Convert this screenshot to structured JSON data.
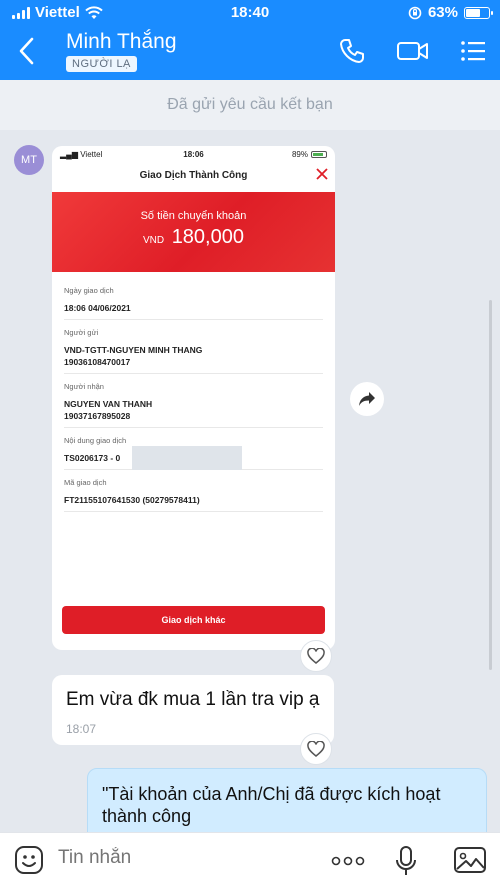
{
  "status_bar": {
    "carrier": "Viettel",
    "time": "18:40",
    "battery": "63%",
    "battery_level": 0.63
  },
  "header": {
    "contact_name": "Minh Thắng",
    "badge": "NGƯỜI LẠ"
  },
  "banner": {
    "text": "Đã gửi yêu cầu kết bạn"
  },
  "avatar": {
    "initials": "MT"
  },
  "receipt": {
    "status": {
      "carrier": "Viettel",
      "time": "18:06",
      "battery": "89%"
    },
    "title": "Giao Dịch Thành Công",
    "amount_label": "Số tiền chuyển khoản",
    "currency": "VND",
    "amount": "180,000",
    "rows": [
      {
        "label": "Ngày giao dịch",
        "value": "18:06 04/06/2021"
      },
      {
        "label": "Người gửi",
        "value": "VND-TGTT-NGUYEN MINH THANG",
        "value2": "19036108470017"
      },
      {
        "label": "Người nhận",
        "value": "NGUYEN VAN THANH",
        "value2": "19037167895028"
      },
      {
        "label": "Nội dung giao dịch",
        "value": "TS0206173 - 0"
      },
      {
        "label": "Mã giao dịch",
        "value": "FT21155107641530 (50279578411)"
      }
    ],
    "button": "Giao dịch khác"
  },
  "messages": [
    {
      "text": "Em vừa đk mua 1 lần tra vip ạ",
      "time": "18:07"
    },
    {
      "text": "\"Tài khoản của Anh/Chị đã được kích hoạt thành công"
    }
  ],
  "input": {
    "placeholder": "Tin nhắn"
  }
}
